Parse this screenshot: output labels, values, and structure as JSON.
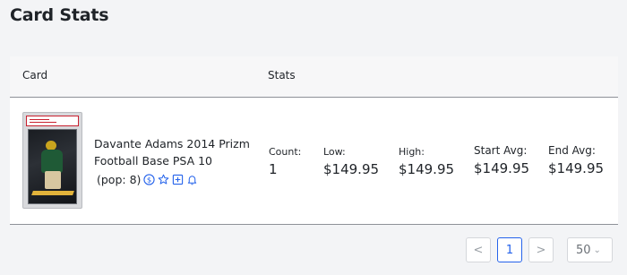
{
  "page": {
    "title": "Card Stats"
  },
  "table": {
    "headers": {
      "card": "Card",
      "stats": "Stats"
    },
    "rows": [
      {
        "card_title_line1": "Davante Adams 2014 Prizm",
        "card_title_line2": "Football Base PSA 10",
        "pop": "(pop: 8)",
        "icons": [
          "dollar-circle-icon",
          "star-icon",
          "plus-square-icon",
          "bell-icon"
        ],
        "stats": {
          "count_label": "Count:",
          "count": "1",
          "low_label": "Low:",
          "low": "$149.95",
          "high_label": "High:",
          "high": "$149.95",
          "start_avg_label": "Start Avg:",
          "start_avg": "$149.95",
          "end_avg_label": "End Avg:",
          "end_avg": "$149.95"
        }
      }
    ]
  },
  "pagination": {
    "prev": "<",
    "current": "1",
    "next": ">",
    "per_page": "50"
  },
  "colors": {
    "accent": "#2563eb",
    "background": "#f3f4f6"
  }
}
